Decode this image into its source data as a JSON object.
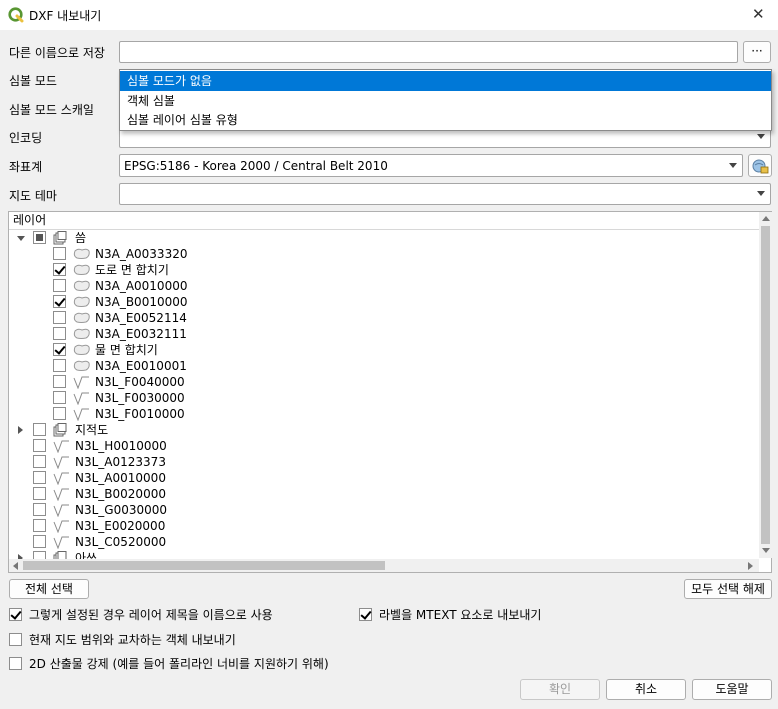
{
  "window": {
    "title": "DXF 내보내기",
    "close_glyph": "✕",
    "app_icon": "qgis-logo-icon"
  },
  "form": {
    "save_as_label": "다른 이름으로 저장",
    "save_as_value": "",
    "browse_label": "···",
    "symbol_mode_label": "심볼 모드",
    "symbol_scale_label": "심볼 모드 스캐일",
    "encoding_label": "인코딩",
    "crs_label": "좌표계",
    "crs_value": "EPSG:5186 - Korea 2000 / Central Belt 2010",
    "crs_button_icon": "crs-select-icon",
    "theme_label": "지도 테마",
    "theme_value": ""
  },
  "symbol_mode_dropdown": {
    "options": [
      "심볼 모드가 없음",
      "객체 심볼",
      "심볼 레이어 심볼 유형"
    ],
    "selected_index": 0
  },
  "layers": {
    "header": "레이어",
    "rows": [
      {
        "label": "씀",
        "type": "group",
        "check": "partial",
        "expanded": true,
        "level": 0
      },
      {
        "label": "N3A_A0033320",
        "type": "polygon",
        "check": "unchecked",
        "level": 1
      },
      {
        "label": "도로 면 합치기",
        "type": "polygon",
        "check": "checked",
        "level": 1
      },
      {
        "label": "N3A_A0010000",
        "type": "polygon",
        "check": "unchecked",
        "level": 1
      },
      {
        "label": "N3A_B0010000",
        "type": "polygon",
        "check": "checked",
        "level": 1
      },
      {
        "label": "N3A_E0052114",
        "type": "polygon",
        "check": "unchecked",
        "level": 1
      },
      {
        "label": "N3A_E0032111",
        "type": "polygon",
        "check": "unchecked",
        "level": 1
      },
      {
        "label": "물 면 합치기",
        "type": "polygon",
        "check": "checked",
        "level": 1
      },
      {
        "label": "N3A_E0010001",
        "type": "polygon",
        "check": "unchecked",
        "level": 1
      },
      {
        "label": "N3L_F0040000",
        "type": "line",
        "check": "unchecked",
        "level": 1
      },
      {
        "label": "N3L_F0030000",
        "type": "line",
        "check": "unchecked",
        "level": 1
      },
      {
        "label": "N3L_F0010000",
        "type": "line",
        "check": "unchecked",
        "level": 1
      },
      {
        "label": "지적도",
        "type": "group",
        "check": "unchecked",
        "expanded": false,
        "level": 0
      },
      {
        "label": "N3L_H0010000",
        "type": "line",
        "check": "unchecked",
        "level": 0
      },
      {
        "label": "N3L_A0123373",
        "type": "line",
        "check": "unchecked",
        "level": 0
      },
      {
        "label": "N3L_A0010000",
        "type": "line",
        "check": "unchecked",
        "level": 0
      },
      {
        "label": "N3L_B0020000",
        "type": "line",
        "check": "unchecked",
        "level": 0
      },
      {
        "label": "N3L_G0030000",
        "type": "line",
        "check": "unchecked",
        "level": 0
      },
      {
        "label": "N3L_E0020000",
        "type": "line",
        "check": "unchecked",
        "level": 0
      },
      {
        "label": "N3L_C0520000",
        "type": "line",
        "check": "unchecked",
        "level": 0
      },
      {
        "label": "아쓰",
        "type": "group",
        "check": "unchecked",
        "expanded": false,
        "level": 0
      }
    ]
  },
  "buttons": {
    "select_all": "전체 선택",
    "deselect_all": "모두 선택 해제",
    "ok": "확인",
    "cancel": "취소",
    "help": "도움말"
  },
  "options": {
    "layer_title_as_name": {
      "label": "그렇게 설정된 경우 레이어 제목을 이름으로 사용",
      "checked": true
    },
    "labels_as_mtext": {
      "label": "라벨을 MTEXT 요소로 내보내기",
      "checked": true
    },
    "export_intersecting": {
      "label": "현재 지도 범위와 교차하는 객체 내보내기",
      "checked": false
    },
    "force_2d": {
      "label": "2D 산출물 강제 (예를 들어 폴리라인 너비를 지원하기 위해)",
      "checked": false
    }
  },
  "colors": {
    "accent": "#0078d7",
    "qgis_green": "#589632",
    "qgis_yellow": "#ebc13f"
  }
}
